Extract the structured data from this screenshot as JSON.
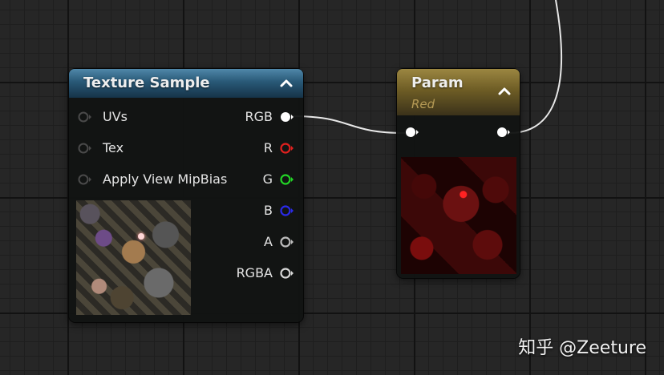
{
  "texture_sample_node": {
    "title": "Texture Sample",
    "collapse_icon": "chevron-up-icon",
    "inputs": [
      {
        "label": "UVs",
        "connected": false
      },
      {
        "label": "Tex",
        "connected": false
      },
      {
        "label": "Apply View MipBias",
        "connected": false
      }
    ],
    "outputs": [
      {
        "label": "RGB",
        "color": "#ffffff",
        "connected": true
      },
      {
        "label": "R",
        "color": "#e0201e",
        "connected": false
      },
      {
        "label": "G",
        "color": "#22d426",
        "connected": false
      },
      {
        "label": "B",
        "color": "#2a2ae8",
        "connected": false
      },
      {
        "label": "A",
        "color": "#bdbdbd",
        "connected": false
      },
      {
        "label": "RGBA",
        "color": "#d8d8d8",
        "connected": false
      }
    ]
  },
  "param_node": {
    "title": "Param",
    "subtitle": "Red",
    "collapse_icon": "chevron-up-icon",
    "input_pin": {
      "color": "#ffffff",
      "connected": true
    },
    "output_pin": {
      "color": "#ffffff",
      "connected": true
    }
  },
  "colors": {
    "texture_header": "#285876",
    "param_header": "#6e5d25",
    "wire": "#e8e8e8",
    "graph_background": "#262626"
  },
  "watermark": "知乎 @Zeeture"
}
